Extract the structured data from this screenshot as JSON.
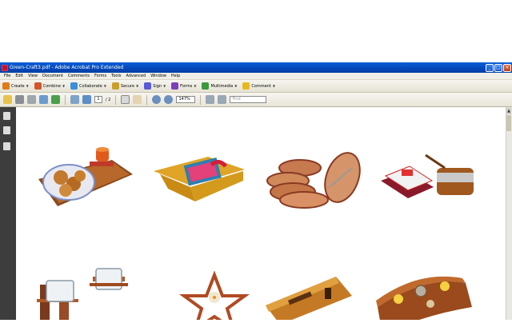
{
  "window": {
    "title": "Green-Craft3.pdf - Adobe Acrobat Pro Extended"
  },
  "menu": [
    "File",
    "Edit",
    "View",
    "Document",
    "Comments",
    "Forms",
    "Tools",
    "Advanced",
    "Window",
    "Help"
  ],
  "tasks": [
    {
      "label": "Create",
      "icon": "create-icon",
      "color": "#e07b1a"
    },
    {
      "label": "Combine",
      "icon": "combine-icon",
      "color": "#d4552c"
    },
    {
      "label": "Collaborate",
      "icon": "collaborate-icon",
      "color": "#3b8fd8"
    },
    {
      "label": "Secure",
      "icon": "lock-icon",
      "color": "#c9a12a"
    },
    {
      "label": "Sign",
      "icon": "pen-icon",
      "color": "#5a5ad8"
    },
    {
      "label": "Forms",
      "icon": "forms-icon",
      "color": "#7a3fb8"
    },
    {
      "label": "Multimedia",
      "icon": "multimedia-icon",
      "color": "#3a9a3a"
    },
    {
      "label": "Comment",
      "icon": "comment-icon",
      "color": "#e8b820"
    }
  ],
  "nav": {
    "current_page": "1",
    "total_pages": "/ 2",
    "zoom": "147%",
    "find_placeholder": "Find"
  },
  "crafts": [
    {
      "name": "tray-with-cookies"
    },
    {
      "name": "yellow-bamboo-basket"
    },
    {
      "name": "woven-oval-baskets"
    },
    {
      "name": "matchbox-holder-with-ashtray"
    },
    {
      "name": "candle-holders-on-sticks"
    },
    {
      "name": "star-candle-holder"
    },
    {
      "name": "bamboo-pen-stand"
    },
    {
      "name": "log-candle-holder"
    }
  ]
}
